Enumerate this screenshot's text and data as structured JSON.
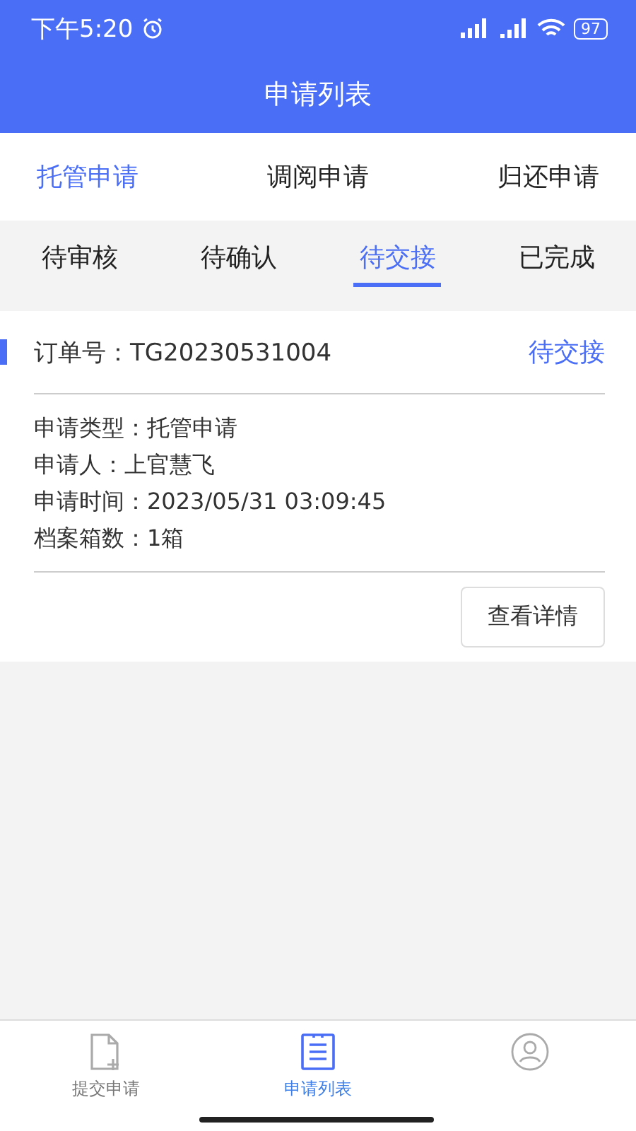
{
  "status_bar": {
    "time": "下午5:20",
    "battery": "97"
  },
  "header": {
    "title": "申请列表"
  },
  "tabs": [
    {
      "label": "托管申请",
      "selected": true
    },
    {
      "label": "调阅申请",
      "selected": false
    },
    {
      "label": "归还申请",
      "selected": false
    }
  ],
  "sub_tabs": [
    {
      "label": "待审核",
      "selected": false
    },
    {
      "label": "待确认",
      "selected": false
    },
    {
      "label": "待交接",
      "selected": true
    },
    {
      "label": "已完成",
      "selected": false
    }
  ],
  "orders": [
    {
      "order_no": "订单号：TG20230531004",
      "status": "待交接",
      "fields": [
        "申请类型：托管申请",
        "申请人：上官慧飞",
        "申请时间：2023/05/31 03:09:45",
        "档案箱数：1箱"
      ],
      "button": "查看详情"
    }
  ],
  "bottom_nav": [
    {
      "kind": "submit",
      "label": "提交申请",
      "selected": false
    },
    {
      "kind": "list",
      "label": "申请列表",
      "selected": true
    },
    {
      "kind": "profile",
      "selected": false
    }
  ]
}
